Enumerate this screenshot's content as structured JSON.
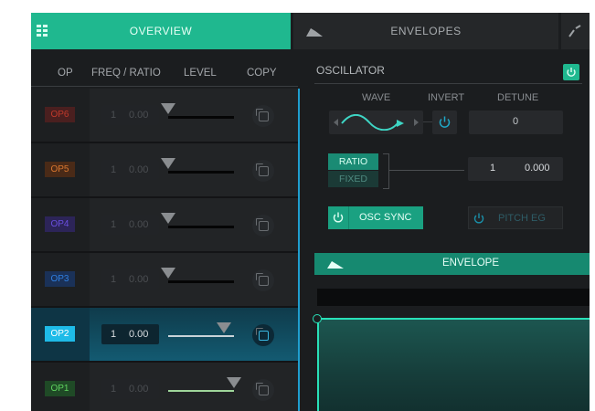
{
  "tabs": [
    {
      "label": "OVERVIEW",
      "icon": "grid-icon",
      "active": true
    },
    {
      "label": "ENVELOPES",
      "icon": "envelope-shape-icon",
      "active": false
    }
  ],
  "tab_more_icon": "curve-icon",
  "columns": {
    "op": "OP",
    "freq_ratio": "FREQ / RATIO",
    "level": "LEVEL",
    "copy": "COPY"
  },
  "operators": [
    {
      "name": "OP6",
      "coarse": "1",
      "fine": "0.00",
      "level": 0.0,
      "color": "#c0392b",
      "bg": "#4a1f1f",
      "selected": false
    },
    {
      "name": "OP5",
      "coarse": "1",
      "fine": "0.00",
      "level": 0.0,
      "color": "#d9772f",
      "bg": "#4a2a17",
      "selected": false
    },
    {
      "name": "OP4",
      "coarse": "1",
      "fine": "0.00",
      "level": 0.0,
      "color": "#6a4fe0",
      "bg": "#2c2458",
      "selected": false
    },
    {
      "name": "OP3",
      "coarse": "1",
      "fine": "0.00",
      "level": 0.0,
      "color": "#2f7fe0",
      "bg": "#1a3158",
      "selected": false
    },
    {
      "name": "OP2",
      "coarse": "1",
      "fine": "0.00",
      "level": 0.85,
      "color": "#ffffff",
      "bg": "#1ebbe8",
      "selected": true
    },
    {
      "name": "OP1",
      "coarse": "1",
      "fine": "0.00",
      "level": 1.0,
      "color": "#5fd35f",
      "bg": "#1f4a26",
      "selected": false
    }
  ],
  "oscillator": {
    "title": "OSCILLATOR",
    "wave_label": "WAVE",
    "invert_label": "INVERT",
    "detune_label": "DETUNE",
    "detune_value": "0",
    "ratio_label": "RATIO",
    "fixed_label": "FIXED",
    "ratio_coarse": "1",
    "ratio_fine": "0.000",
    "osc_sync_label": "OSC SYNC",
    "pitch_eg_label": "PITCH EG"
  },
  "envelope": {
    "title": "ENVELOPE"
  },
  "colors": {
    "accent": "#1fb88f",
    "selected_row": "#124a5e",
    "panel": "#1b1d1f"
  }
}
